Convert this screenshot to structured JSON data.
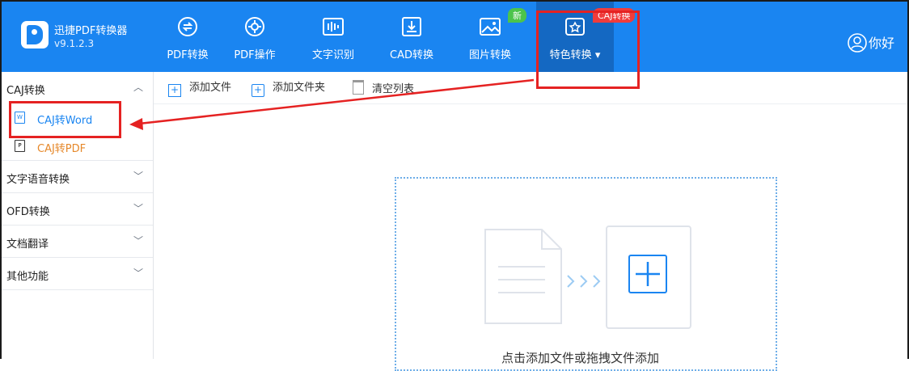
{
  "app": {
    "name": "迅捷PDF转换器",
    "version": "v9.1.2.3"
  },
  "nav": [
    {
      "label": "PDF转换",
      "icon": "pdf-convert-icon"
    },
    {
      "label": "PDF操作",
      "icon": "pdf-operation-icon"
    },
    {
      "label": "文字识别",
      "icon": "ocr-icon"
    },
    {
      "label": "CAD转换",
      "icon": "cad-convert-icon"
    },
    {
      "label": "图片转换",
      "icon": "image-convert-icon",
      "badge": "新"
    },
    {
      "label": "特色转换",
      "icon": "special-convert-icon",
      "badge": "CAJ转换"
    }
  ],
  "user": {
    "label": "你好"
  },
  "sidebar": {
    "groups": [
      {
        "label": "CAJ转换",
        "expanded": true,
        "items": [
          {
            "label": "CAJ转Word",
            "selected": true
          },
          {
            "label": "CAJ转PDF"
          }
        ]
      },
      {
        "label": "文字语音转换"
      },
      {
        "label": "OFD转换"
      },
      {
        "label": "文档翻译"
      },
      {
        "label": "其他功能"
      }
    ]
  },
  "toolbar": {
    "add_file": "添加文件",
    "add_folder": "添加文件夹",
    "clear_list": "清空列表"
  },
  "dropzone": {
    "hint": "点击添加文件或拖拽文件添加"
  },
  "colors": {
    "brand": "#1a85f1",
    "annotation": "#e52222",
    "new_badge": "#4cc44c"
  }
}
